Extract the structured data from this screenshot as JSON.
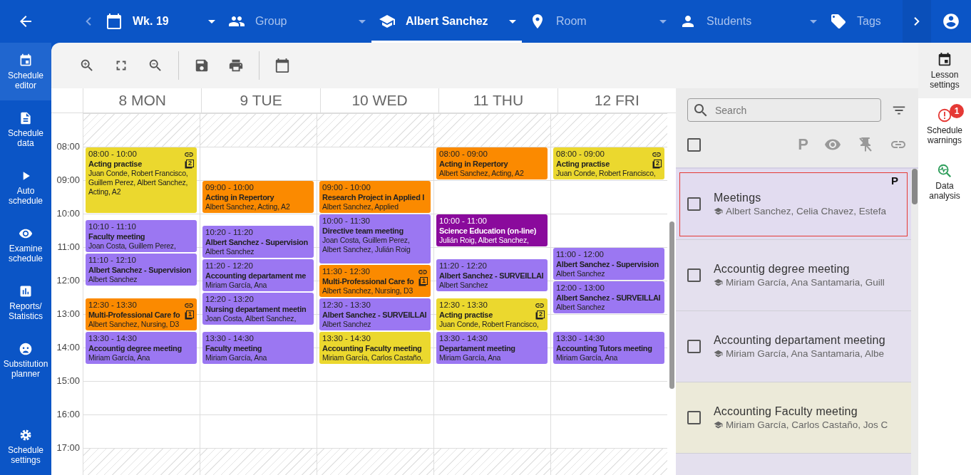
{
  "top_bar": {
    "items": [
      {
        "label": "Wk. 19",
        "active": true,
        "selected": false,
        "dropdown": true
      },
      {
        "label": "Group",
        "active": false,
        "selected": false,
        "dropdown": true
      },
      {
        "label": "Albert Sanchez",
        "active": true,
        "selected": true,
        "dropdown": true
      },
      {
        "label": "Room",
        "active": false,
        "selected": false,
        "dropdown": true
      },
      {
        "label": "Students",
        "active": false,
        "selected": false,
        "dropdown": true
      },
      {
        "label": "Tags",
        "active": false,
        "selected": false,
        "dropdown": false
      }
    ]
  },
  "left_nav": {
    "items": [
      {
        "label": "Schedule\neditor",
        "selected": true
      },
      {
        "label": "Schedule\ndata",
        "selected": false
      },
      {
        "label": "Auto\nschedule",
        "selected": false
      },
      {
        "label": "Examine\nschedule",
        "selected": false
      },
      {
        "label": "Reports/\nStatistics",
        "selected": false
      },
      {
        "label": "Substitution\nplanner",
        "selected": false
      },
      {
        "label": "Schedule\nsettings",
        "selected": false
      }
    ]
  },
  "calendar": {
    "days": [
      "8 MON",
      "9 TUE",
      "10 WED",
      "11 THU",
      "12 FRI"
    ],
    "hours": [
      "08:00",
      "09:00",
      "10:00",
      "11:00",
      "12:00",
      "13:00",
      "14:00",
      "15:00",
      "16:00",
      "17:00"
    ],
    "events": [
      [
        {
          "time": "08:00 - 10:00",
          "title": "Acting practise",
          "people": "Juan Conde, Robert Francisco,\nGuillem Perez, Albert Sanchez,\nActing, A2",
          "color": "#ebd82e",
          "linked": true,
          "copies": "2"
        },
        {
          "time": "10:10 - 11:10",
          "title": "Faculty meeting",
          "people": "Joan Costa, Guillem Perez,",
          "color": "#9b77f2",
          "linked": false
        },
        {
          "time": "11:10 - 12:10",
          "title": "Albert Sanchez - Supervision",
          "people": "Albert Sanchez",
          "color": "#9b77f2",
          "linked": false
        },
        {
          "time": "12:30 - 13:30",
          "title": "Multi-Professional Care fo",
          "people": "Albert Sanchez, Nursing, D3",
          "color": "#fb8a00",
          "linked": true,
          "copies": "1"
        },
        {
          "time": "13:30 - 14:30",
          "title": "Accountig degree meeting",
          "people": "Miriam García, Ana",
          "color": "#9b77f2",
          "linked": false
        }
      ],
      [
        {
          "time": "09:00 - 10:00",
          "title": "Acting in Repertory",
          "people": "Albert Sanchez, Acting, A2",
          "color": "#fb8a00",
          "linked": false
        },
        {
          "time": "10:20 - 11:20",
          "title": "Albert Sanchez - Supervision",
          "people": "Albert Sanchez",
          "color": "#9b77f2",
          "linked": false
        },
        {
          "time": "11:20 - 12:20",
          "title": "Accounting departament me",
          "people": "Miriam García, Ana",
          "color": "#9b77f2",
          "linked": false
        },
        {
          "time": "12:20 - 13:20",
          "title": "Nursing departament meetin",
          "people": "Joan Costa, Albert Sanchez,",
          "color": "#9b77f2",
          "linked": false
        },
        {
          "time": "13:30 - 14:30",
          "title": "Faculty meeting",
          "people": "Miriam García, Ana",
          "color": "#9b77f2",
          "linked": false
        }
      ],
      [
        {
          "time": "09:00 - 10:00",
          "title": "Research Project in Applied I",
          "people": "Albert Sanchez, Applied",
          "color": "#fb8a00",
          "linked": false
        },
        {
          "time": "10:00 - 11:30",
          "title": "Directive team meeting",
          "people": "Joan Costa, Guillem Perez,\nAlbert Sanchez, Julián Roig",
          "color": "#9b77f2",
          "linked": false
        },
        {
          "time": "11:30 - 12:30",
          "title": "Multi-Professional Care fo",
          "people": "Albert Sanchez, Nursing, D3",
          "color": "#fb8a00",
          "linked": true,
          "copies": "1"
        },
        {
          "time": "12:30 - 13:30",
          "title": "Albert Sanchez - SURVEILLAI",
          "people": "Albert Sanchez",
          "color": "#9b77f2",
          "linked": false
        },
        {
          "time": "13:30 - 14:30",
          "title": "Accounting Faculty meeting",
          "people": "Miriam García, Carlos Castaño,",
          "color": "#ebd82e",
          "linked": false
        }
      ],
      [
        {
          "time": "08:00 - 09:00",
          "title": "Acting in Repertory",
          "people": "Albert Sanchez, Acting, A2",
          "color": "#fb8a00",
          "linked": false
        },
        {
          "time": "10:00 - 11:00",
          "title": "Science Education (on-line)",
          "people": "Julián Roig, Albert Sanchez,",
          "color": "#8a0a9c",
          "linked": false
        },
        {
          "time": "11:20 - 12:20",
          "title": "Albert Sanchez - SURVEILLAI",
          "people": "Albert Sanchez",
          "color": "#9b77f2",
          "linked": false
        },
        {
          "time": "12:30 - 13:30",
          "title": "Acting practise",
          "people": "Juan Conde, Robert Francisco,",
          "color": "#ebd82e",
          "linked": true,
          "copies": "2"
        },
        {
          "time": "13:30 - 14:30",
          "title": "Departament meeting",
          "people": "Miriam García, Ana",
          "color": "#9b77f2",
          "linked": false
        }
      ],
      [
        {
          "time": "08:00 - 09:00",
          "title": "Acting practise",
          "people": "Juan Conde, Robert Francisco,",
          "color": "#ebd82e",
          "linked": true,
          "copies": "2"
        },
        {
          "time": "11:00 - 12:00",
          "title": "Albert Sanchez - Supervision",
          "people": "Albert Sanchez",
          "color": "#9b77f2",
          "linked": false
        },
        {
          "time": "12:00 - 13:00",
          "title": "Albert Sanchez - SURVEILLAI",
          "people": "Albert Sanchez",
          "color": "#9b77f2",
          "linked": false
        },
        {
          "time": "13:30 - 14:30",
          "title": "Accounting Tutors meeting",
          "people": "Miriam García, Ana",
          "color": "#9b77f2",
          "linked": false
        }
      ]
    ]
  },
  "lessons_panel": {
    "search": {
      "placeholder": "Search"
    },
    "select_all_checked": false,
    "pinned_column": "P",
    "items": [
      {
        "name": "Meetings",
        "teachers": "Albert Sanchez, Celia Chavez, Estefa",
        "color": "#e2dcf0",
        "selected": true,
        "checked": false,
        "mark": "P"
      },
      {
        "name": "Accountig degree meeting",
        "teachers": "Miriam García, Ana Santamaria, Guill",
        "color": "#e4e0ee",
        "selected": false,
        "checked": false
      },
      {
        "name": "Accounting departament meeting",
        "teachers": "Miriam García, Ana Santamaria, Albe",
        "color": "#e4e0ee",
        "selected": false,
        "checked": false
      },
      {
        "name": "Accounting Faculty meeting",
        "teachers": "Miriam García, Carlos Castaño, Jos C",
        "color": "#ecead9",
        "selected": false,
        "checked": false
      },
      {
        "color": "#e4e0ee",
        "selected": false
      }
    ]
  },
  "right_nav": {
    "items": [
      {
        "label": "Lesson\nsettings",
        "selected": true
      },
      {
        "label": "Schedule\nwarnings",
        "selected": false,
        "badge": "1"
      },
      {
        "label": "Data\nanalysis",
        "selected": false
      }
    ]
  }
}
